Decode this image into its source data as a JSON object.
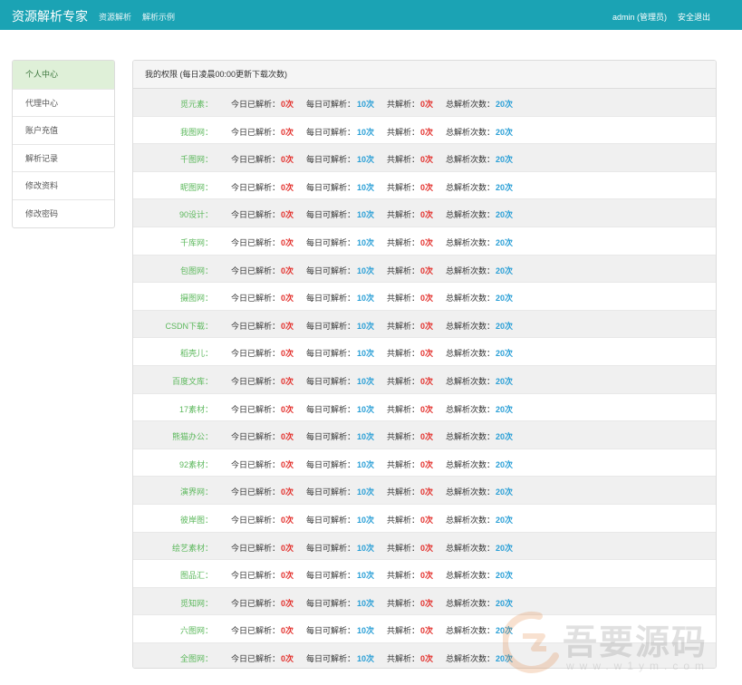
{
  "navbar": {
    "brand": "资源解析专家",
    "links": [
      "资源解析",
      "解析示例"
    ],
    "user": "admin (管理员)",
    "logout": "安全退出",
    "color": "#1ba3b4"
  },
  "sidebar": {
    "items": [
      "个人中心",
      "代理中心",
      "账户充值",
      "解析记录",
      "修改资料",
      "修改密码"
    ],
    "active_index": 0
  },
  "panel": {
    "heading": "我的权限 (每日凌晨00:00更新下载次数)",
    "labels": {
      "today": "今日已解析：",
      "daily": "每日可解析：",
      "total": "共解析：",
      "overall": "总解析次数："
    },
    "rows": [
      {
        "site": "觅元素：",
        "today": "0次",
        "daily": "10次",
        "total": "0次",
        "overall": "20次"
      },
      {
        "site": "我图网：",
        "today": "0次",
        "daily": "10次",
        "total": "0次",
        "overall": "20次"
      },
      {
        "site": "千图网：",
        "today": "0次",
        "daily": "10次",
        "total": "0次",
        "overall": "20次"
      },
      {
        "site": "昵图网：",
        "today": "0次",
        "daily": "10次",
        "total": "0次",
        "overall": "20次"
      },
      {
        "site": "90设计：",
        "today": "0次",
        "daily": "10次",
        "total": "0次",
        "overall": "20次"
      },
      {
        "site": "千库网：",
        "today": "0次",
        "daily": "10次",
        "total": "0次",
        "overall": "20次"
      },
      {
        "site": "包图网：",
        "today": "0次",
        "daily": "10次",
        "total": "0次",
        "overall": "20次"
      },
      {
        "site": "摄图网：",
        "today": "0次",
        "daily": "10次",
        "total": "0次",
        "overall": "20次"
      },
      {
        "site": "CSDN下载：",
        "today": "0次",
        "daily": "10次",
        "total": "0次",
        "overall": "20次"
      },
      {
        "site": "稻壳儿：",
        "today": "0次",
        "daily": "10次",
        "total": "0次",
        "overall": "20次"
      },
      {
        "site": "百度文库：",
        "today": "0次",
        "daily": "10次",
        "total": "0次",
        "overall": "20次"
      },
      {
        "site": "17素材：",
        "today": "0次",
        "daily": "10次",
        "total": "0次",
        "overall": "20次"
      },
      {
        "site": "熊猫办公：",
        "today": "0次",
        "daily": "10次",
        "total": "0次",
        "overall": "20次"
      },
      {
        "site": "92素材：",
        "today": "0次",
        "daily": "10次",
        "total": "0次",
        "overall": "20次"
      },
      {
        "site": "演界网：",
        "today": "0次",
        "daily": "10次",
        "total": "0次",
        "overall": "20次"
      },
      {
        "site": "彼岸图：",
        "today": "0次",
        "daily": "10次",
        "total": "0次",
        "overall": "20次"
      },
      {
        "site": "绘艺素材：",
        "today": "0次",
        "daily": "10次",
        "total": "0次",
        "overall": "20次"
      },
      {
        "site": "图品汇：",
        "today": "0次",
        "daily": "10次",
        "total": "0次",
        "overall": "20次"
      },
      {
        "site": "觅知网：",
        "today": "0次",
        "daily": "10次",
        "total": "0次",
        "overall": "20次"
      },
      {
        "site": "六图网：",
        "today": "0次",
        "daily": "10次",
        "total": "0次",
        "overall": "20次"
      },
      {
        "site": "全图网：",
        "today": "0次",
        "daily": "10次",
        "total": "0次",
        "overall": "20次"
      }
    ]
  },
  "watermark": {
    "text": "吾要源码",
    "url": "www.w1ym.com"
  }
}
